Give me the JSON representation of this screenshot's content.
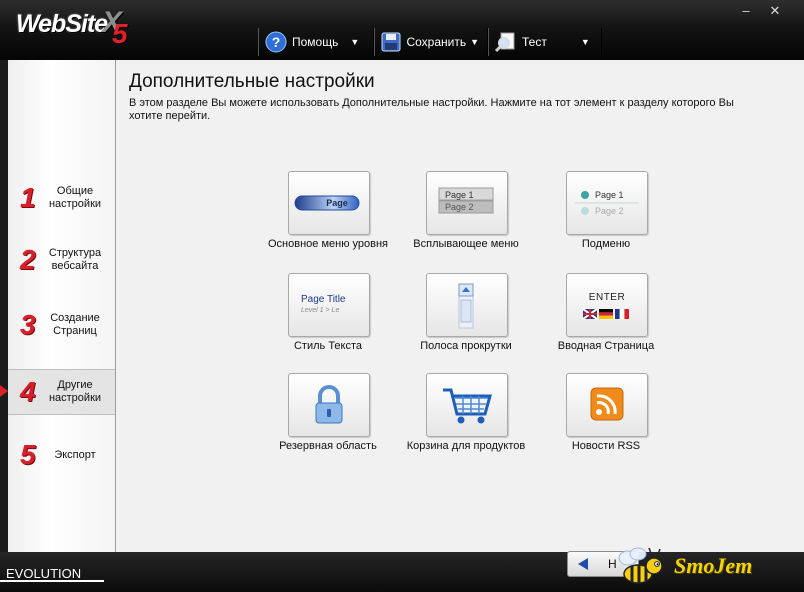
{
  "app": {
    "logo_word": "WebSite",
    "logo_x": "X",
    "logo_version": "5",
    "minimize_glyph": "–",
    "close_glyph": "✕",
    "footer_label": "EVOLUTION"
  },
  "toolbar": {
    "help_label": "Помощь",
    "save_label": "Сохранить",
    "test_label": "Тест",
    "dropdown_glyph": "▼",
    "icons": {
      "help": "help-icon",
      "save": "floppy-disk-icon",
      "test": "magnifier-icon"
    }
  },
  "sidebar": {
    "steps": [
      {
        "num": "1",
        "label": "Общие настройки"
      },
      {
        "num": "2",
        "label": "Структура вебсайта"
      },
      {
        "num": "3",
        "label": "Создание Страниц"
      },
      {
        "num": "4",
        "label": "Другие настройки",
        "active": true
      },
      {
        "num": "5",
        "label": "Экспорт"
      }
    ]
  },
  "main": {
    "title": "Дополнительные настройки",
    "description": "В этом разделе Вы можете  использовать Дополнительные настройки. Нажмите на тот элемент к разделу которого Вы хотите перейти.",
    "tiles": [
      {
        "label": "Основное меню уровня",
        "icon": "main-menu-icon",
        "preview_text": "Page"
      },
      {
        "label": "Всплывающее меню",
        "icon": "popup-menu-icon",
        "preview_line1": "Page 1",
        "preview_line2": "Page 2"
      },
      {
        "label": "Подменю",
        "icon": "submenu-icon",
        "preview_line1": "Page 1",
        "preview_line2": "Page 2"
      },
      {
        "label": "Стиль Текста",
        "icon": "text-style-icon",
        "preview_line1": "Page Title",
        "preview_line2": "Level 1 > Le"
      },
      {
        "label": "Полоса прокрутки",
        "icon": "scrollbar-icon"
      },
      {
        "label": "Вводная Страница",
        "icon": "intro-page-icon",
        "preview_text": "ENTER"
      },
      {
        "label": "Резервная область",
        "icon": "padlock-icon"
      },
      {
        "label": "Корзина для продуктов",
        "icon": "shopping-cart-icon"
      },
      {
        "label": "Новости RSS",
        "icon": "rss-icon"
      }
    ]
  },
  "footer": {
    "back_label": "Н",
    "brand_text": "SmoJem",
    "brand_icon": "bee-icon",
    "back_icon": "back-arrow-icon"
  },
  "colors": {
    "accent_red": "#d8202b",
    "toolbar_bg": "#0d0d0d",
    "panel_bg": "#f1f1f1",
    "rss_orange": "#f08a1a",
    "nav_blue": "#1e4fa8"
  }
}
